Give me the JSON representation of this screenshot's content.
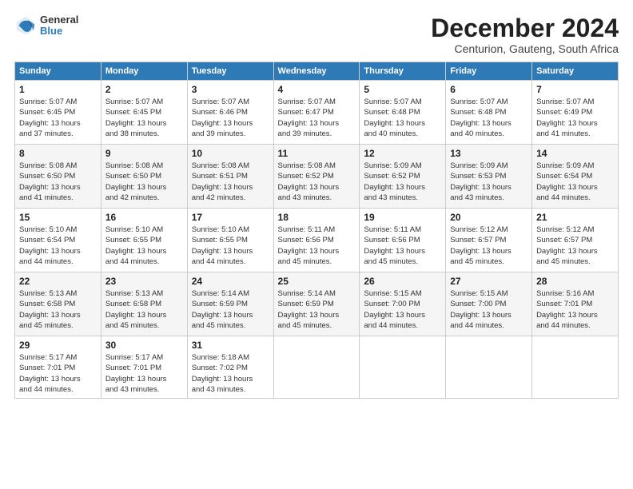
{
  "logo": {
    "line1": "General",
    "line2": "Blue"
  },
  "title": "December 2024",
  "location": "Centurion, Gauteng, South Africa",
  "headers": [
    "Sunday",
    "Monday",
    "Tuesday",
    "Wednesday",
    "Thursday",
    "Friday",
    "Saturday"
  ],
  "weeks": [
    [
      {
        "day": "1",
        "sunrise": "5:07 AM",
        "sunset": "6:45 PM",
        "daylight": "13 hours and 37 minutes."
      },
      {
        "day": "2",
        "sunrise": "5:07 AM",
        "sunset": "6:45 PM",
        "daylight": "13 hours and 38 minutes."
      },
      {
        "day": "3",
        "sunrise": "5:07 AM",
        "sunset": "6:46 PM",
        "daylight": "13 hours and 39 minutes."
      },
      {
        "day": "4",
        "sunrise": "5:07 AM",
        "sunset": "6:47 PM",
        "daylight": "13 hours and 39 minutes."
      },
      {
        "day": "5",
        "sunrise": "5:07 AM",
        "sunset": "6:48 PM",
        "daylight": "13 hours and 40 minutes."
      },
      {
        "day": "6",
        "sunrise": "5:07 AM",
        "sunset": "6:48 PM",
        "daylight": "13 hours and 40 minutes."
      },
      {
        "day": "7",
        "sunrise": "5:07 AM",
        "sunset": "6:49 PM",
        "daylight": "13 hours and 41 minutes."
      }
    ],
    [
      {
        "day": "8",
        "sunrise": "5:08 AM",
        "sunset": "6:50 PM",
        "daylight": "13 hours and 41 minutes."
      },
      {
        "day": "9",
        "sunrise": "5:08 AM",
        "sunset": "6:50 PM",
        "daylight": "13 hours and 42 minutes."
      },
      {
        "day": "10",
        "sunrise": "5:08 AM",
        "sunset": "6:51 PM",
        "daylight": "13 hours and 42 minutes."
      },
      {
        "day": "11",
        "sunrise": "5:08 AM",
        "sunset": "6:52 PM",
        "daylight": "13 hours and 43 minutes."
      },
      {
        "day": "12",
        "sunrise": "5:09 AM",
        "sunset": "6:52 PM",
        "daylight": "13 hours and 43 minutes."
      },
      {
        "day": "13",
        "sunrise": "5:09 AM",
        "sunset": "6:53 PM",
        "daylight": "13 hours and 43 minutes."
      },
      {
        "day": "14",
        "sunrise": "5:09 AM",
        "sunset": "6:54 PM",
        "daylight": "13 hours and 44 minutes."
      }
    ],
    [
      {
        "day": "15",
        "sunrise": "5:10 AM",
        "sunset": "6:54 PM",
        "daylight": "13 hours and 44 minutes."
      },
      {
        "day": "16",
        "sunrise": "5:10 AM",
        "sunset": "6:55 PM",
        "daylight": "13 hours and 44 minutes."
      },
      {
        "day": "17",
        "sunrise": "5:10 AM",
        "sunset": "6:55 PM",
        "daylight": "13 hours and 44 minutes."
      },
      {
        "day": "18",
        "sunrise": "5:11 AM",
        "sunset": "6:56 PM",
        "daylight": "13 hours and 45 minutes."
      },
      {
        "day": "19",
        "sunrise": "5:11 AM",
        "sunset": "6:56 PM",
        "daylight": "13 hours and 45 minutes."
      },
      {
        "day": "20",
        "sunrise": "5:12 AM",
        "sunset": "6:57 PM",
        "daylight": "13 hours and 45 minutes."
      },
      {
        "day": "21",
        "sunrise": "5:12 AM",
        "sunset": "6:57 PM",
        "daylight": "13 hours and 45 minutes."
      }
    ],
    [
      {
        "day": "22",
        "sunrise": "5:13 AM",
        "sunset": "6:58 PM",
        "daylight": "13 hours and 45 minutes."
      },
      {
        "day": "23",
        "sunrise": "5:13 AM",
        "sunset": "6:58 PM",
        "daylight": "13 hours and 45 minutes."
      },
      {
        "day": "24",
        "sunrise": "5:14 AM",
        "sunset": "6:59 PM",
        "daylight": "13 hours and 45 minutes."
      },
      {
        "day": "25",
        "sunrise": "5:14 AM",
        "sunset": "6:59 PM",
        "daylight": "13 hours and 45 minutes."
      },
      {
        "day": "26",
        "sunrise": "5:15 AM",
        "sunset": "7:00 PM",
        "daylight": "13 hours and 44 minutes."
      },
      {
        "day": "27",
        "sunrise": "5:15 AM",
        "sunset": "7:00 PM",
        "daylight": "13 hours and 44 minutes."
      },
      {
        "day": "28",
        "sunrise": "5:16 AM",
        "sunset": "7:01 PM",
        "daylight": "13 hours and 44 minutes."
      }
    ],
    [
      {
        "day": "29",
        "sunrise": "5:17 AM",
        "sunset": "7:01 PM",
        "daylight": "13 hours and 44 minutes."
      },
      {
        "day": "30",
        "sunrise": "5:17 AM",
        "sunset": "7:01 PM",
        "daylight": "13 hours and 43 minutes."
      },
      {
        "day": "31",
        "sunrise": "5:18 AM",
        "sunset": "7:02 PM",
        "daylight": "13 hours and 43 minutes."
      },
      null,
      null,
      null,
      null
    ]
  ]
}
